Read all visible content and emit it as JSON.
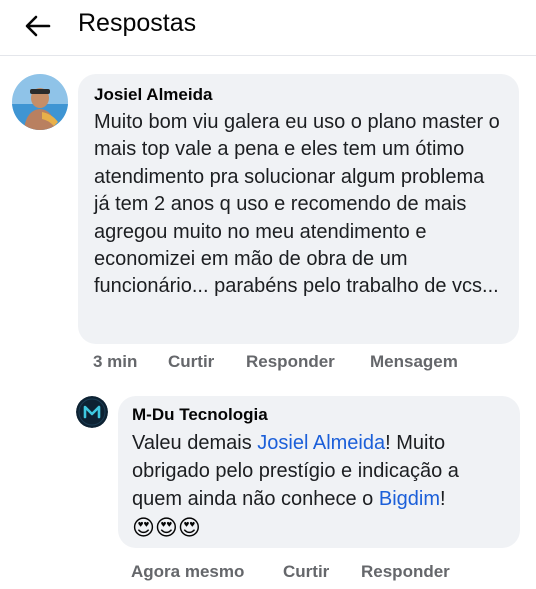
{
  "header": {
    "title": "Respostas"
  },
  "comment": {
    "author": "Josiel Almeida",
    "text": "Muito bom viu galera eu uso o plano master o mais top vale a pena e eles tem um ótimo atendimento pra solucionar algum problema já tem 2 anos q uso e recomendo de mais agregou muito no meu atendimento e economizei em mão de obra de um funcionário... parabéns pelo trabalho de vcs...",
    "time": "3 min",
    "actions": {
      "like": "Curtir",
      "reply": "Responder",
      "message": "Mensagem"
    }
  },
  "reply": {
    "author": "M-Du Tecnologia",
    "text_part1": "Valeu demais ",
    "mention1": "Josiel Almeida",
    "text_part2": "! Muito obrigado pelo prestígio e indicação a quem ainda não conhece o ",
    "mention2": "Bigdim",
    "text_part3": "!",
    "emojis": "😍😍😍",
    "time": "Agora mesmo",
    "actions": {
      "like": "Curtir",
      "reply": "Responder"
    }
  },
  "colors": {
    "bubble": "#f0f2f5",
    "link": "#1b5fd9",
    "meta": "#65676b"
  },
  "icons": {
    "back": "arrow-left-icon"
  }
}
